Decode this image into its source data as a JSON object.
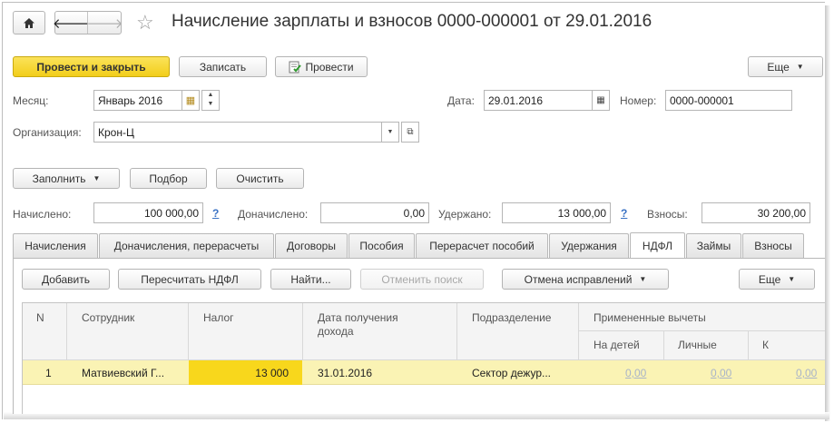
{
  "header": {
    "title": "Начисление зарплаты и взносов 0000-000001 от 29.01.2016"
  },
  "toolbar": {
    "post_close": "Провести и закрыть",
    "save": "Записать",
    "post": "Провести",
    "more": "Еще"
  },
  "form": {
    "month_label": "Месяц:",
    "month_value": "Январь 2016",
    "date_label": "Дата:",
    "date_value": "29.01.2016",
    "number_label": "Номер:",
    "number_value": "0000-000001",
    "org_label": "Организация:",
    "org_value": "Крон-Ц"
  },
  "actions": {
    "fill": "Заполнить",
    "select": "Подбор",
    "clear": "Очистить"
  },
  "totals": {
    "accrued_label": "Начислено:",
    "accrued_value": "100 000,00",
    "additional_label": "Доначислено:",
    "additional_value": "0,00",
    "withheld_label": "Удержано:",
    "withheld_value": "13 000,00",
    "contrib_label": "Взносы:",
    "contrib_value": "30 200,00",
    "help": "?"
  },
  "tabs": [
    {
      "label": "Начисления"
    },
    {
      "label": "Доначисления, перерасчеты"
    },
    {
      "label": "Договоры"
    },
    {
      "label": "Пособия"
    },
    {
      "label": "Перерасчет пособий"
    },
    {
      "label": "Удержания"
    },
    {
      "label": "НДФЛ"
    },
    {
      "label": "Займы"
    },
    {
      "label": "Взносы"
    }
  ],
  "table_toolbar": {
    "add": "Добавить",
    "recalc": "Пересчитать НДФЛ",
    "find": "Найти...",
    "cancel_search": "Отменить поиск",
    "cancel_corrections": "Отмена исправлений",
    "more": "Еще"
  },
  "table": {
    "col_n": "N",
    "col_employee": "Сотрудник",
    "col_tax": "Налог",
    "col_date_line1": "Дата получения",
    "col_date_line2": "дохода",
    "col_dept": "Подразделение",
    "col_deductions": "Примененные вычеты",
    "col_children": "На детей",
    "col_personal": "Личные",
    "col_k": "К",
    "rows": [
      {
        "n": "1",
        "employee": "Матвиевский Г...",
        "tax": "13 000",
        "date": "31.01.2016",
        "dept": "Сектор дежур...",
        "children": "0,00",
        "personal": "0,00",
        "k": "0,00"
      }
    ]
  },
  "colors": {
    "primary_button": "#f5d62a",
    "selected_row": "#faf3b4",
    "selected_cell": "#f8d71c"
  }
}
